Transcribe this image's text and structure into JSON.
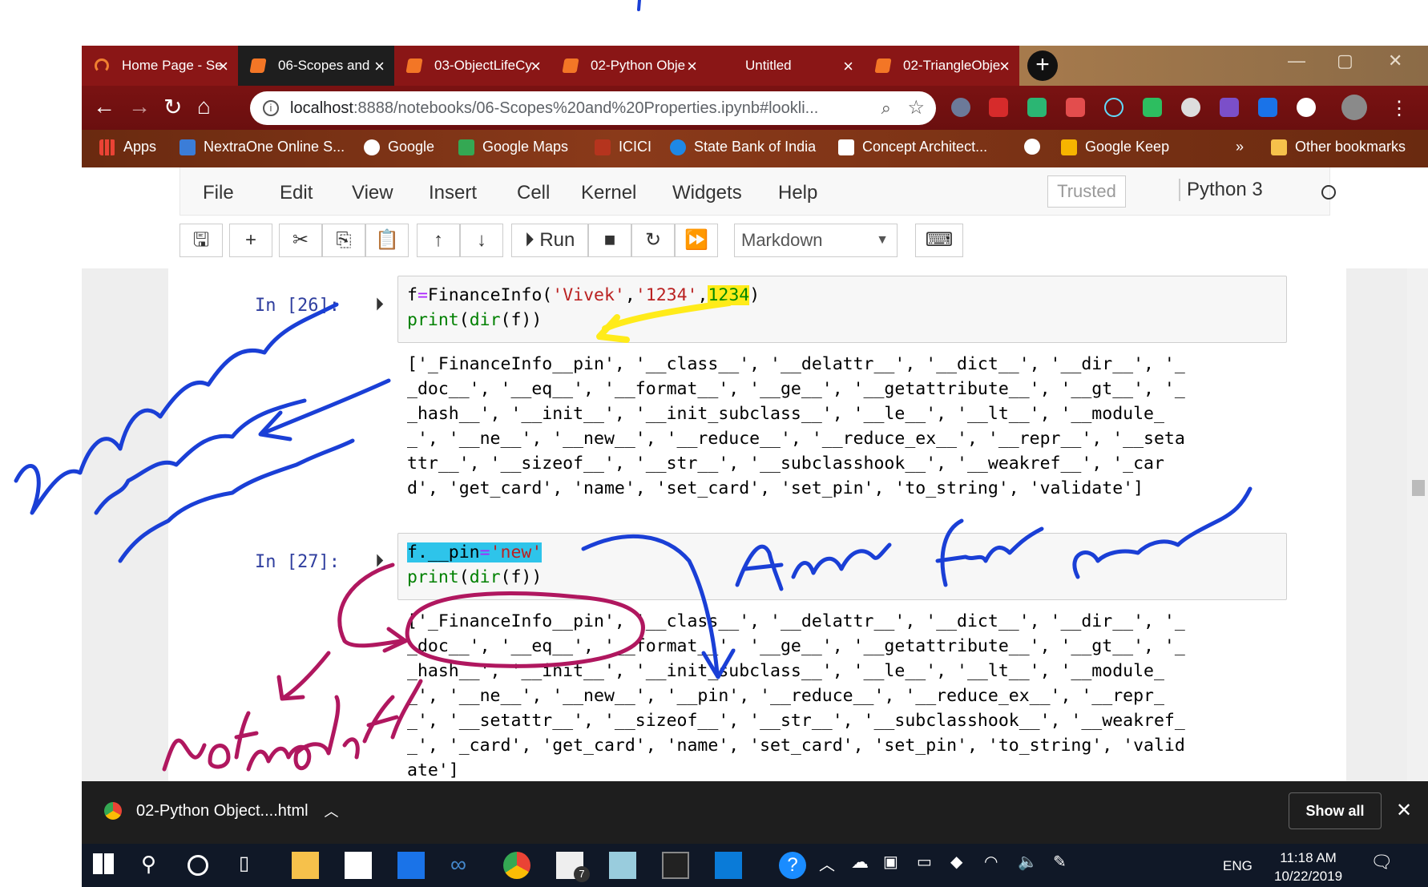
{
  "colors": {
    "yellow_highlight": "#ffeb1a",
    "cyan_highlight": "#2ec4ea",
    "ink_blue": "#1a3fd6",
    "ink_magenta": "#b0175f",
    "prompt_blue": "#303f9f"
  },
  "browser": {
    "tabs": [
      {
        "title": "Home Page - Se",
        "icon": "swirl-icon"
      },
      {
        "title": "06-Scopes and",
        "icon": "jupyter-icon"
      },
      {
        "title": "03-ObjectLifeCy",
        "icon": "jupyter-icon"
      },
      {
        "title": "02-Python Obje",
        "icon": "jupyter-icon"
      },
      {
        "title": "Untitled",
        "icon": ""
      },
      {
        "title": "02-TriangleObje",
        "icon": "jupyter-icon"
      }
    ],
    "url_host": "localhost",
    "url_path": ":8888/notebooks/06-Scopes%20and%20Properties.ipynb#lookli...",
    "bookmarks": [
      "Apps",
      "NextraOne Online S...",
      "Google",
      "Google Maps",
      "ICICI",
      "State Bank of India",
      "Concept Architect...",
      "Google Keep"
    ],
    "bookmarks_more": "»",
    "other_bookmarks": "Other bookmarks"
  },
  "jupyter": {
    "menu": [
      "File",
      "Edit",
      "View",
      "Insert",
      "Cell",
      "Kernel",
      "Widgets",
      "Help"
    ],
    "trusted": "Trusted",
    "kernel": "Python 3",
    "run_label": "Run",
    "cell_type": "Markdown"
  },
  "cells": [
    {
      "prompt": "In [26]:",
      "code_line1": {
        "a": "f",
        "op": "=",
        "b": "FinanceInfo(",
        "s1": "'Vivek'",
        "c1": ",",
        "s2": "'1234'",
        "c2": ",",
        "n": "1234",
        "end": ")"
      },
      "code_line2": {
        "fn1": "print",
        "p1": "(",
        "fn2": "dir",
        "rest": "(f))"
      },
      "output": [
        "['_FinanceInfo__pin', '__class__', '__delattr__', '__dict__', '__dir__', '_",
        "_doc__', '__eq__', '__format__', '__ge__', '__getattribute__', '__gt__', '_",
        "_hash__', '__init__', '__init_subclass__', '__le__', '__lt__', '__module_",
        "_', '__ne__', '__new__', '__reduce__', '__reduce_ex__', '__repr__', '__seta",
        "ttr__', '__sizeof__', '__str__', '__subclasshook__', '__weakref__', '_car",
        "d', 'get_card', 'name', 'set_card', 'set_pin', 'to_string', 'validate']"
      ]
    },
    {
      "prompt": "In [27]:",
      "code_line1": {
        "a": "f.__pin",
        "op": "=",
        "s": "'new'"
      },
      "code_line2": {
        "fn1": "print",
        "p1": "(",
        "fn2": "dir",
        "rest": "(f))"
      },
      "output": [
        "['_FinanceInfo__pin', '__class__', '__delattr__', '__dict__', '__dir__', '_",
        "_doc__', '__eq__', '__format__', '__ge__', '__getattribute__', '__gt__', '_",
        "_hash__', '__init__', '__init_subclass__', '__le__', '__lt__', '__module_",
        "_', '__ne__', '__new__', '__pin', '__reduce__', '__reduce_ex__', '__repr_",
        "_', '__setattr__', '__sizeof__', '__str__', '__subclasshook__', '__weakref_",
        "_', '_card', 'get_card', 'name', 'set_card', 'set_pin', 'to_string', 'valid",
        "ate']"
      ]
    }
  ],
  "downloads": {
    "file": "02-Python Object....html",
    "show_all": "Show all"
  },
  "taskbar": {
    "lang": "ENG",
    "time": "11:18 AM",
    "date": "10/22/2019",
    "mail_badge": "7"
  }
}
